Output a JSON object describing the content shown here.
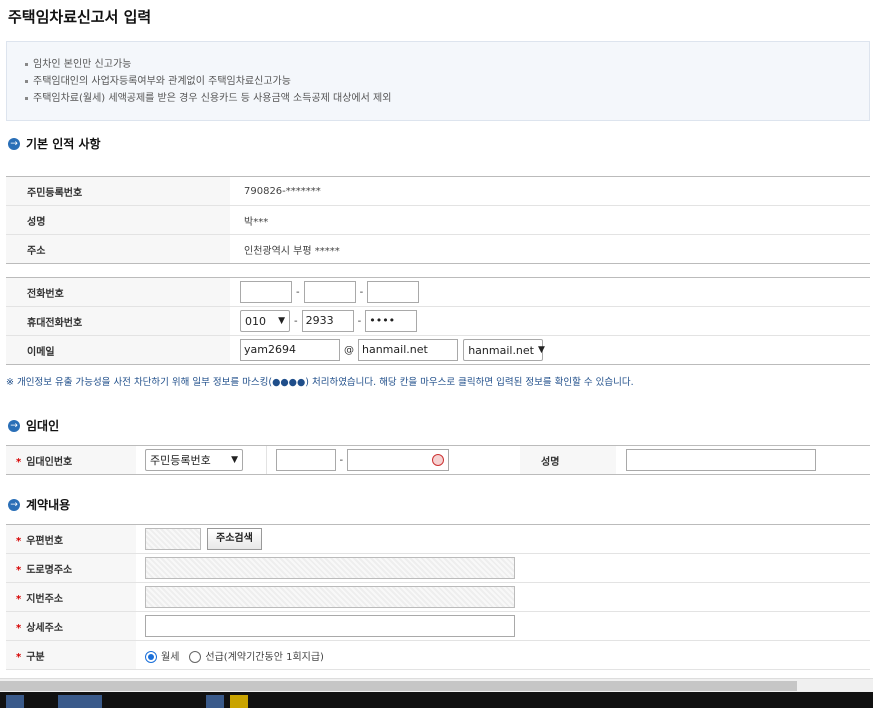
{
  "page_title": "주택임차료신고서 입력",
  "notice": [
    "임차인 본인만 신고가능",
    "주택임대인의 사업자등록여부와 관계없이 주택임차료신고가능",
    "주택임차료(월세) 세액공제를 받은 경우 신용카드 등 사용금액 소득공제 대상에서 제외"
  ],
  "basic": {
    "heading": "기본 인적 사항",
    "rows": [
      {
        "label": "주민등록번호",
        "value": "790826-*******"
      },
      {
        "label": "성명",
        "value": "박***"
      },
      {
        "label": "주소",
        "value": "인천광역시 부평 *****"
      }
    ],
    "phone_label": "전화번호",
    "phone": [
      "",
      "",
      ""
    ],
    "mobile_label": "휴대전화번호",
    "mobile": {
      "prefix": "010",
      "mid": "2933",
      "last": "••••"
    },
    "email_label": "이메일",
    "email": {
      "user": "yam2694",
      "at": "@",
      "domain": "hanmail.net",
      "domain_select": "hanmail.net"
    }
  },
  "privacy_note": "※ 개인정보 유출 가능성을 사전 차단하기 위해 일부 정보를 마스킹(●●●●) 처리하였습니다. 해당 칸을 마우스로 클릭하면 입력된 정보를 확인할 수 있습니다.",
  "landlord": {
    "heading": "임대인",
    "id_label": "임대인번호",
    "id_type": "주민등록번호",
    "id_first": "",
    "id_second": "",
    "name_label": "성명",
    "name_value": ""
  },
  "contract": {
    "heading": "계약내용",
    "postal_label": "우편번호",
    "postal_value": "",
    "search_button": "주소검색",
    "road_label": "도로명주소",
    "lot_label": "지번주소",
    "detail_label": "상세주소",
    "type_label": "구분",
    "type_options": [
      "월세",
      "선급(계약기간동안 1회지급)"
    ],
    "type_selected": "월세"
  },
  "colors": {
    "accent": "#2a6fb7",
    "required": "#d60000",
    "note": "#1f4e8a"
  }
}
